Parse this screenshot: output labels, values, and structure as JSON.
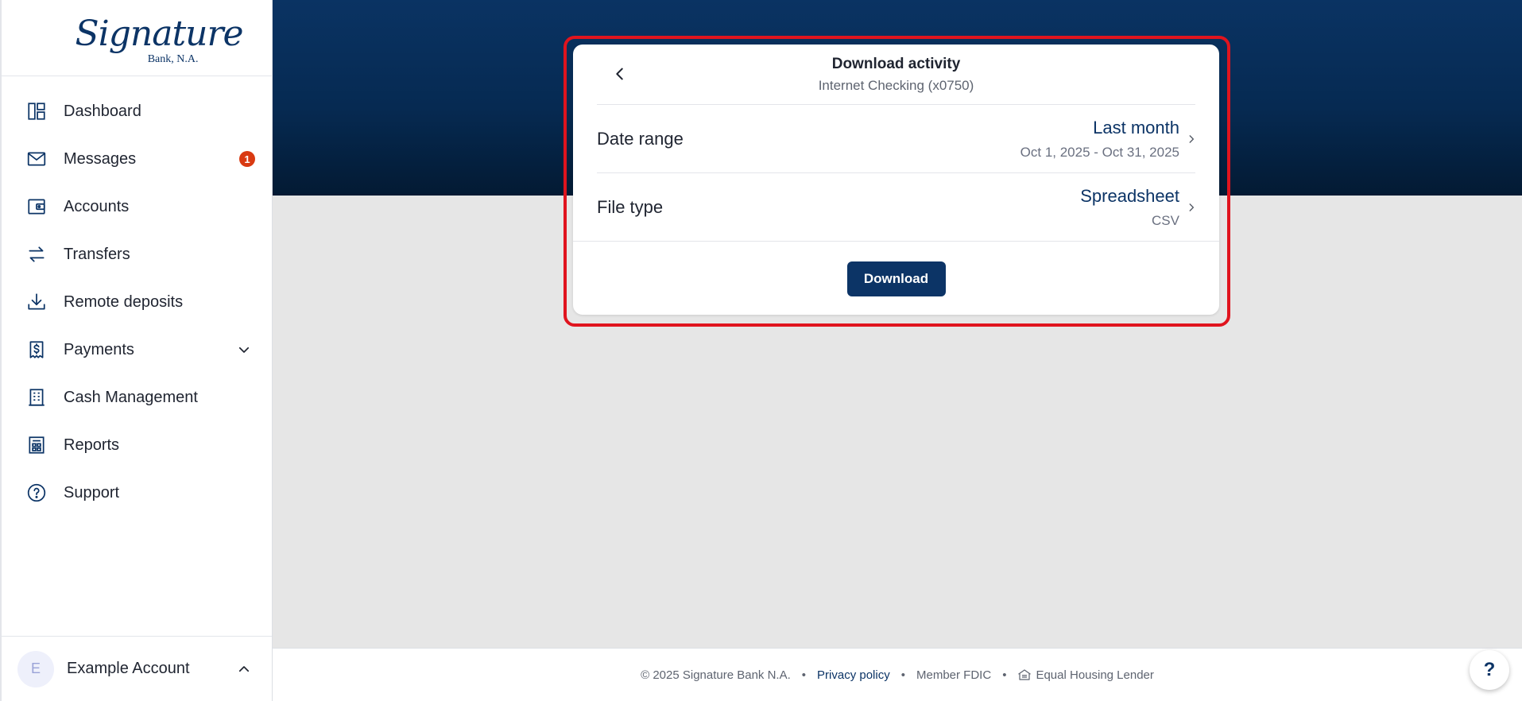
{
  "brand": {
    "logo_script": "Signature",
    "logo_sub": "Bank, N.A.",
    "color": "#0c3466"
  },
  "sidebar": {
    "items": [
      {
        "label": "Dashboard",
        "icon": "dashboard-icon"
      },
      {
        "label": "Messages",
        "icon": "mail-icon",
        "badge": "1"
      },
      {
        "label": "Accounts",
        "icon": "wallet-icon"
      },
      {
        "label": "Transfers",
        "icon": "transfer-arrows-icon"
      },
      {
        "label": "Remote deposits",
        "icon": "download-tray-icon"
      },
      {
        "label": "Payments",
        "icon": "receipt-dollar-icon",
        "expandable": true
      },
      {
        "label": "Cash Management",
        "icon": "building-icon"
      },
      {
        "label": "Reports",
        "icon": "report-icon"
      },
      {
        "label": "Support",
        "icon": "help-circle-icon"
      }
    ],
    "account": {
      "initial": "E",
      "name": "Example Account"
    }
  },
  "dialog": {
    "title": "Download activity",
    "subtitle": "Internet Checking (x0750)",
    "date_range": {
      "label": "Date range",
      "value": "Last month",
      "detail": "Oct 1, 2025 - Oct 31, 2025"
    },
    "file_type": {
      "label": "File type",
      "value": "Spreadsheet",
      "detail": "CSV"
    },
    "download_label": "Download"
  },
  "footer": {
    "copyright": "© 2025 Signature Bank N.A.",
    "privacy": "Privacy policy",
    "fdic": "Member FDIC",
    "housing": "Equal Housing Lender",
    "separator": "•"
  },
  "help": {
    "label": "?"
  },
  "colors": {
    "accent": "#0c3466",
    "badge": "#d93a12",
    "highlight": "#e0141e",
    "hero": "#062a52"
  }
}
